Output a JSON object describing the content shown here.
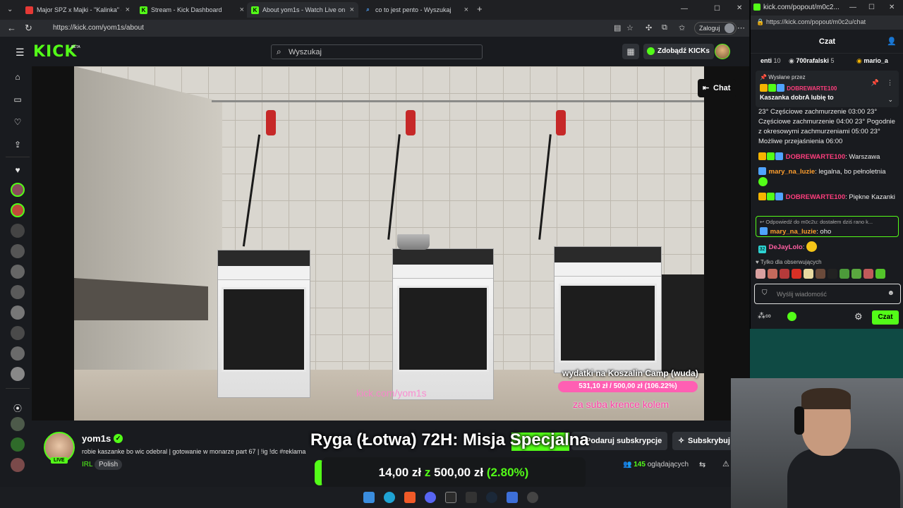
{
  "browser": {
    "tabs": [
      {
        "title": "Major SPZ x Majki - \"Kalinka\" - Yo",
        "color": "#e53935"
      },
      {
        "title": "Stream - Kick Dashboard",
        "color": "#53fc18"
      },
      {
        "title": "About yom1s - Watch Live on",
        "color": "#53fc18"
      },
      {
        "title": "co to jest pento - Wyszukaj",
        "color": "#4fa3ff"
      }
    ],
    "url": "https://kick.com/yom1s/about",
    "login_label": "Zaloguj"
  },
  "kick": {
    "logo": "KICK",
    "beta": "BETA",
    "search_placeholder": "Wyszukaj",
    "get_kicks": "Zdobądź KICKs"
  },
  "stream": {
    "chat_toggle": "Chat",
    "overlay": {
      "wydatki": "wydatki na Koszalin Camp (wuda)",
      "progress_text": "531,10 zł / 500,00 zł (106.22%)",
      "progress_fraction": 1.0622,
      "za_suba": "za suba krence kolem",
      "watermark": "kick.com/yom1s"
    },
    "streamer": "yom1s",
    "live": "LIVE",
    "title": "robie kaszanke bo wic odebral | gotowanie w monarze part 67 | !ig !dc #reklama",
    "category": "IRL",
    "tag": "Polish",
    "gift_label": "Podaruj subskrypcje",
    "subscribe_label": "Subskrybuj",
    "viewers_count": "145",
    "viewers_label": "oglądających",
    "headline": "Ryga (Łotwa) 72H: Misja Specjalna",
    "goal_current": "14,00 zł",
    "goal_sep": "z",
    "goal_target": "500,00 zł",
    "goal_percent": "(2.80%)"
  },
  "chat": {
    "window_title": "kick.com/popout/m0c2...",
    "url": "https://kick.com/popout/m0c2u/chat",
    "header": "Czat",
    "leaders": [
      {
        "name": "enti",
        "count": "10"
      },
      {
        "name": "700rafalski",
        "count": "5"
      },
      {
        "name": "mario_a",
        "count": ""
      }
    ],
    "pinned": {
      "label": "Wysłane przez",
      "user": "DOBREWARTE100",
      "message": "Kaszanka dobrA lubię to"
    },
    "weather_text": "23° Częściowe zachmurzenie 03:00 23° Częściowe zachmurzenie 04:00 23° Pogodnie z okresowymi zachmurzeniami 05:00 23° Możliwe przejaśnienia 06:00",
    "messages": [
      {
        "user": "DOBREWARTE100",
        "text": "Warszawa"
      },
      {
        "user": "mary_na_luzie",
        "text": "legalna, bo pełnoletnia"
      },
      {
        "user": "DOBREWARTE100",
        "text": "Piękne Kazanki"
      }
    ],
    "reply": {
      "context": "Odpowiedź do m0c2u: dostałem dziś rano k...",
      "user": "mary_na_luzie",
      "text": "oho"
    },
    "last_user": "DeJayLolo",
    "last_badge": "32",
    "followers_only": "Tylko dla obserwujących",
    "input_placeholder": "Wyślij wiadomość",
    "send_label": "Czat"
  }
}
